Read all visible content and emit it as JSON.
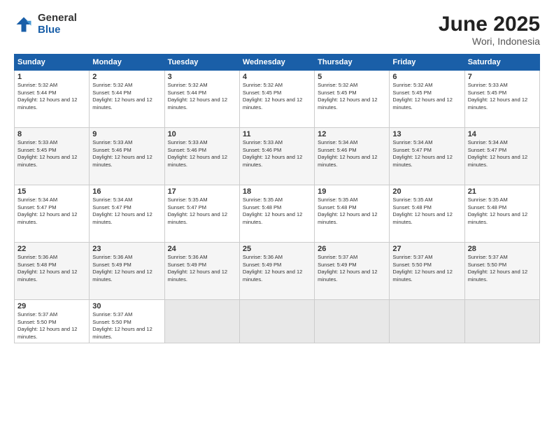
{
  "logo": {
    "general": "General",
    "blue": "Blue"
  },
  "title": "June 2025",
  "subtitle": "Wori, Indonesia",
  "days_header": [
    "Sunday",
    "Monday",
    "Tuesday",
    "Wednesday",
    "Thursday",
    "Friday",
    "Saturday"
  ],
  "weeks": [
    [
      {
        "num": "1",
        "rise": "Sunrise: 5:32 AM",
        "set": "Sunset: 5:44 PM",
        "daylight": "Daylight: 12 hours and 12 minutes."
      },
      {
        "num": "2",
        "rise": "Sunrise: 5:32 AM",
        "set": "Sunset: 5:44 PM",
        "daylight": "Daylight: 12 hours and 12 minutes."
      },
      {
        "num": "3",
        "rise": "Sunrise: 5:32 AM",
        "set": "Sunset: 5:44 PM",
        "daylight": "Daylight: 12 hours and 12 minutes."
      },
      {
        "num": "4",
        "rise": "Sunrise: 5:32 AM",
        "set": "Sunset: 5:45 PM",
        "daylight": "Daylight: 12 hours and 12 minutes."
      },
      {
        "num": "5",
        "rise": "Sunrise: 5:32 AM",
        "set": "Sunset: 5:45 PM",
        "daylight": "Daylight: 12 hours and 12 minutes."
      },
      {
        "num": "6",
        "rise": "Sunrise: 5:32 AM",
        "set": "Sunset: 5:45 PM",
        "daylight": "Daylight: 12 hours and 12 minutes."
      },
      {
        "num": "7",
        "rise": "Sunrise: 5:33 AM",
        "set": "Sunset: 5:45 PM",
        "daylight": "Daylight: 12 hours and 12 minutes."
      }
    ],
    [
      {
        "num": "8",
        "rise": "Sunrise: 5:33 AM",
        "set": "Sunset: 5:45 PM",
        "daylight": "Daylight: 12 hours and 12 minutes."
      },
      {
        "num": "9",
        "rise": "Sunrise: 5:33 AM",
        "set": "Sunset: 5:46 PM",
        "daylight": "Daylight: 12 hours and 12 minutes."
      },
      {
        "num": "10",
        "rise": "Sunrise: 5:33 AM",
        "set": "Sunset: 5:46 PM",
        "daylight": "Daylight: 12 hours and 12 minutes."
      },
      {
        "num": "11",
        "rise": "Sunrise: 5:33 AM",
        "set": "Sunset: 5:46 PM",
        "daylight": "Daylight: 12 hours and 12 minutes."
      },
      {
        "num": "12",
        "rise": "Sunrise: 5:34 AM",
        "set": "Sunset: 5:46 PM",
        "daylight": "Daylight: 12 hours and 12 minutes."
      },
      {
        "num": "13",
        "rise": "Sunrise: 5:34 AM",
        "set": "Sunset: 5:47 PM",
        "daylight": "Daylight: 12 hours and 12 minutes."
      },
      {
        "num": "14",
        "rise": "Sunrise: 5:34 AM",
        "set": "Sunset: 5:47 PM",
        "daylight": "Daylight: 12 hours and 12 minutes."
      }
    ],
    [
      {
        "num": "15",
        "rise": "Sunrise: 5:34 AM",
        "set": "Sunset: 5:47 PM",
        "daylight": "Daylight: 12 hours and 12 minutes."
      },
      {
        "num": "16",
        "rise": "Sunrise: 5:34 AM",
        "set": "Sunset: 5:47 PM",
        "daylight": "Daylight: 12 hours and 12 minutes."
      },
      {
        "num": "17",
        "rise": "Sunrise: 5:35 AM",
        "set": "Sunset: 5:47 PM",
        "daylight": "Daylight: 12 hours and 12 minutes."
      },
      {
        "num": "18",
        "rise": "Sunrise: 5:35 AM",
        "set": "Sunset: 5:48 PM",
        "daylight": "Daylight: 12 hours and 12 minutes."
      },
      {
        "num": "19",
        "rise": "Sunrise: 5:35 AM",
        "set": "Sunset: 5:48 PM",
        "daylight": "Daylight: 12 hours and 12 minutes."
      },
      {
        "num": "20",
        "rise": "Sunrise: 5:35 AM",
        "set": "Sunset: 5:48 PM",
        "daylight": "Daylight: 12 hours and 12 minutes."
      },
      {
        "num": "21",
        "rise": "Sunrise: 5:35 AM",
        "set": "Sunset: 5:48 PM",
        "daylight": "Daylight: 12 hours and 12 minutes."
      }
    ],
    [
      {
        "num": "22",
        "rise": "Sunrise: 5:36 AM",
        "set": "Sunset: 5:48 PM",
        "daylight": "Daylight: 12 hours and 12 minutes."
      },
      {
        "num": "23",
        "rise": "Sunrise: 5:36 AM",
        "set": "Sunset: 5:49 PM",
        "daylight": "Daylight: 12 hours and 12 minutes."
      },
      {
        "num": "24",
        "rise": "Sunrise: 5:36 AM",
        "set": "Sunset: 5:49 PM",
        "daylight": "Daylight: 12 hours and 12 minutes."
      },
      {
        "num": "25",
        "rise": "Sunrise: 5:36 AM",
        "set": "Sunset: 5:49 PM",
        "daylight": "Daylight: 12 hours and 12 minutes."
      },
      {
        "num": "26",
        "rise": "Sunrise: 5:37 AM",
        "set": "Sunset: 5:49 PM",
        "daylight": "Daylight: 12 hours and 12 minutes."
      },
      {
        "num": "27",
        "rise": "Sunrise: 5:37 AM",
        "set": "Sunset: 5:50 PM",
        "daylight": "Daylight: 12 hours and 12 minutes."
      },
      {
        "num": "28",
        "rise": "Sunrise: 5:37 AM",
        "set": "Sunset: 5:50 PM",
        "daylight": "Daylight: 12 hours and 12 minutes."
      }
    ],
    [
      {
        "num": "29",
        "rise": "Sunrise: 5:37 AM",
        "set": "Sunset: 5:50 PM",
        "daylight": "Daylight: 12 hours and 12 minutes."
      },
      {
        "num": "30",
        "rise": "Sunrise: 5:37 AM",
        "set": "Sunset: 5:50 PM",
        "daylight": "Daylight: 12 hours and 12 minutes."
      },
      null,
      null,
      null,
      null,
      null
    ]
  ]
}
